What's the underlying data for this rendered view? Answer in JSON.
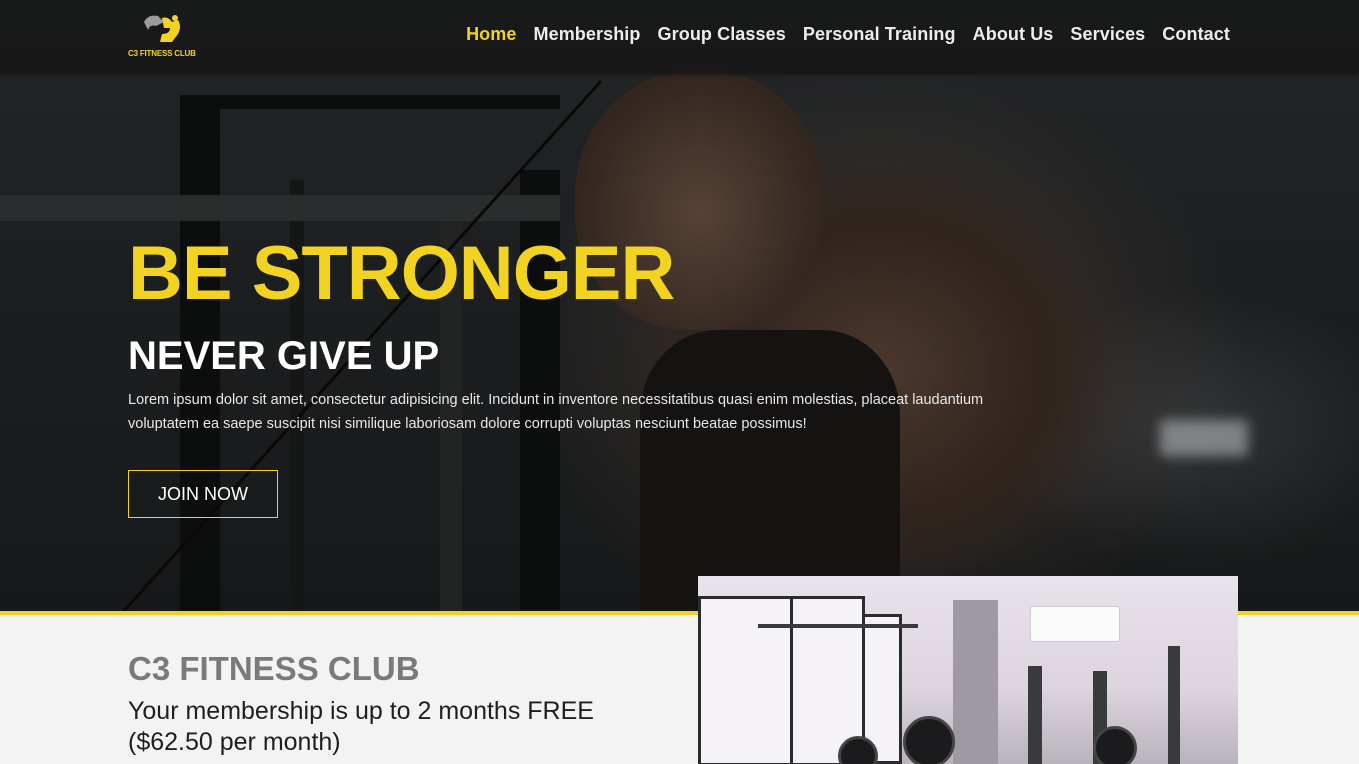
{
  "brand": {
    "logo_text": "C3 FITNESS CLUB"
  },
  "nav": {
    "items": [
      {
        "label": "Home",
        "active": true
      },
      {
        "label": "Membership",
        "active": false
      },
      {
        "label": "Group Classes",
        "active": false
      },
      {
        "label": "Personal Training",
        "active": false
      },
      {
        "label": "About Us",
        "active": false
      },
      {
        "label": "Services",
        "active": false
      },
      {
        "label": "Contact",
        "active": false
      }
    ]
  },
  "hero": {
    "headline": "BE STRONGER",
    "subheadline": "NEVER GIVE UP",
    "lead": "Lorem ipsum dolor sit amet, consectetur adipisicing elit. Incidunt in inventore necessitatibus quasi enim molestias, placeat laudantium voluptatem ea saepe suscipit nisi similique laboriosam dolore corrupti voluptas nesciunt beatae possimus!",
    "cta_label": "JOIN NOW"
  },
  "about": {
    "title": "C3 FITNESS CLUB",
    "promo": "Your membership is up to 2 months FREE ($62.50 per month)"
  },
  "colors": {
    "accent": "#f2d321",
    "nav_bg": "#181818",
    "section_bg": "#f3f3f3"
  }
}
